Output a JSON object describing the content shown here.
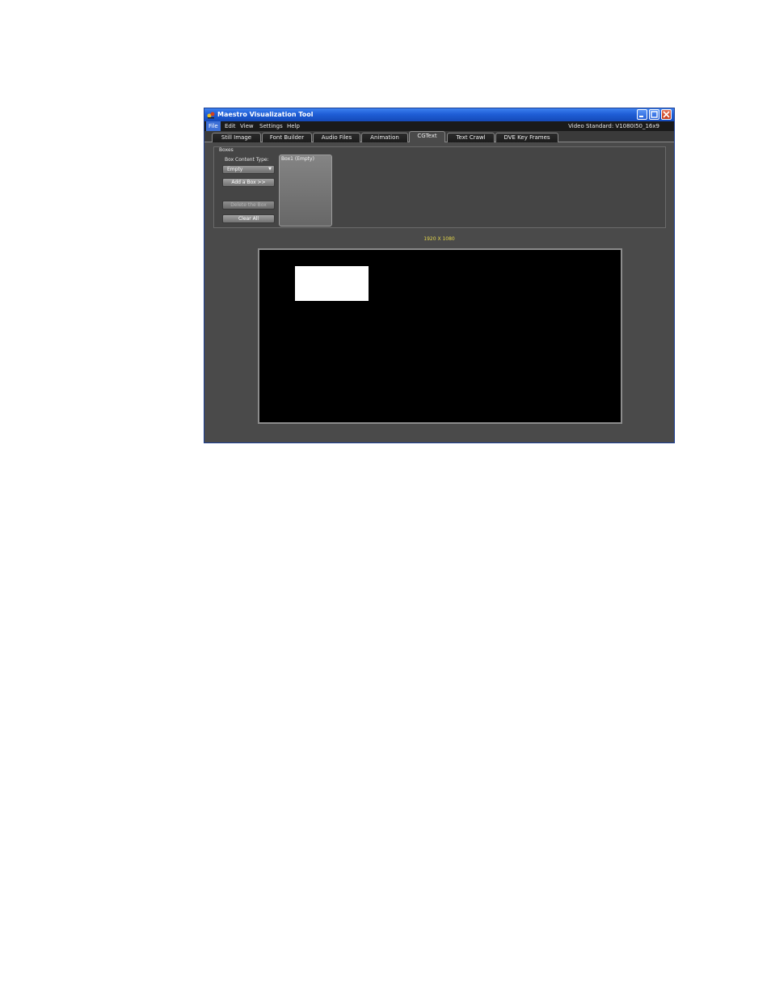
{
  "window": {
    "title": "Maestro Visualization Tool",
    "controls": {
      "minimize": "minimize-icon",
      "maximize": "maximize-icon",
      "close": "close-icon"
    }
  },
  "menu": {
    "items": [
      {
        "label": "File",
        "active": true
      },
      {
        "label": "Edit"
      },
      {
        "label": "View"
      },
      {
        "label": "Settings"
      },
      {
        "label": "Help"
      }
    ],
    "video_standard": "Video Standard: V1080I50_16x9"
  },
  "tabs": [
    {
      "label": "Still Image"
    },
    {
      "label": "Font Builder"
    },
    {
      "label": "Audio Files"
    },
    {
      "label": "Animation"
    },
    {
      "label": "CGText",
      "active": true
    },
    {
      "label": "Text Crawl"
    },
    {
      "label": "DVE Key Frames"
    }
  ],
  "boxes": {
    "group_label": "Boxes",
    "content_type_label": "Box Content Type:",
    "content_type_value": "Empty",
    "add_button": "Add a Box >>",
    "delete_button": "Delete the Box",
    "clear_button": "Clear All",
    "list": [
      "Box1 (Empty)"
    ]
  },
  "canvas": {
    "resolution_label": "1920 X 1080"
  },
  "colors": {
    "titlebar": "#1f5ed6",
    "background": "#4a4a4a",
    "resolution_text": "#e6d84a",
    "canvas": "#000000",
    "box": "#ffffff"
  }
}
